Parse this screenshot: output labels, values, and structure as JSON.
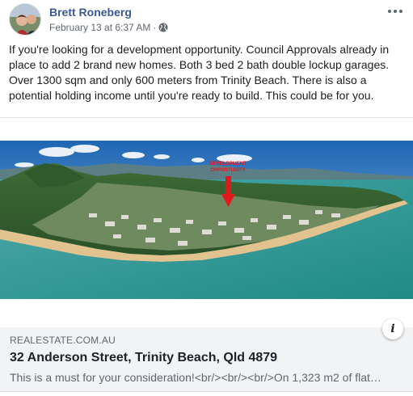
{
  "post": {
    "author": "Brett Roneberg",
    "timestamp": "February 13 at 6:37 AM",
    "separator": "·",
    "audience_icon": "globe-icon",
    "menu_icon": "more-options-icon",
    "text": "If you're looking for a development opportunity. Council Approvals already in place to add 2 brand new homes. Both 3 bed 2 bath double lockup garages. Over 1300 sqm and only 600 meters from Trinity Beach. There is also a potential holding income until you're ready to build. This could be for you."
  },
  "link_preview": {
    "photo_caption_line1": "DEVELOPMENT",
    "photo_caption_line2": "OPPORTUNITY",
    "info_icon_text": "i",
    "domain": "REALESTATE.COM.AU",
    "title": "32 Anderson Street, Trinity Beach, Qld 4879",
    "description": "This is a must for your consideration!<br/><br/><br/>On 1,323 m2 of flat…"
  },
  "colors": {
    "author_link": "#385898",
    "meta_text": "#606770",
    "preview_background": "#f2f3f5",
    "marker_red": "#e0191f"
  }
}
